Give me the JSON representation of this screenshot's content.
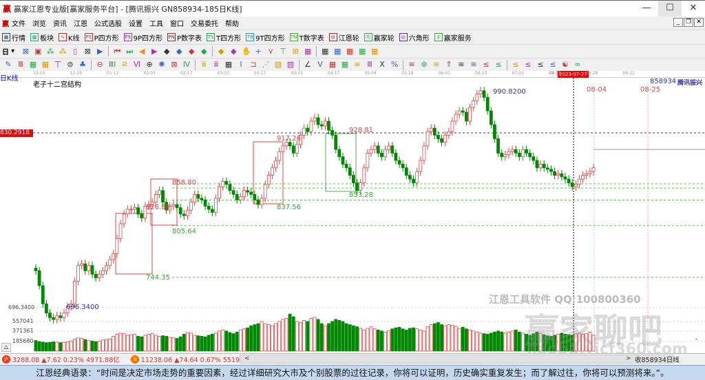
{
  "window": {
    "logo": "赢",
    "title": "赢家江恩专业版[赢家服务平台] - [腾讯振兴  GN858934-185日K线]",
    "minimize": "—",
    "maximize": "☐",
    "close": "✕"
  },
  "menu": {
    "logo": "赢",
    "items": [
      "文件",
      "浏览",
      "资讯",
      "江恩",
      "公式选股",
      "设置",
      "工具",
      "窗口",
      "交易委托",
      "帮助"
    ],
    "mdi": [
      "_",
      "❐",
      "✕"
    ]
  },
  "toolbar1": [
    {
      "icon": "▦",
      "label": "行情",
      "color": "#246"
    },
    {
      "icon": "▩",
      "label": "板块",
      "color": "#2a7"
    },
    {
      "icon": "∿",
      "label": "K线",
      "color": "#d22"
    },
    {
      "icon": "PS",
      "label": "P四方形",
      "color": "#c33"
    },
    {
      "icon": "P9",
      "label": "9P四方形",
      "color": "#a3a"
    },
    {
      "icon": "PN",
      "label": "P数字表",
      "color": "#933"
    },
    {
      "icon": "TS",
      "label": "T四方形",
      "color": "#2a4"
    },
    {
      "icon": "T9",
      "label": "9T四方形",
      "color": "#29a"
    },
    {
      "icon": "TN",
      "label": "T数字表",
      "color": "#4a2"
    },
    {
      "icon": "◎",
      "label": "江恩轮",
      "color": "#a22"
    },
    {
      "icon": "㊈",
      "label": "赢家轮",
      "color": "#3a5"
    },
    {
      "icon": "◎",
      "label": "六角形",
      "color": "#62a"
    },
    {
      "icon": "$",
      "label": "赢家服务",
      "color": "#3a3"
    }
  ],
  "toolbar2": {
    "period": "日",
    "icons": [
      "⊠",
      "▣",
      "⁂",
      "⁂",
      "▯",
      "⊠",
      "▶",
      "⏮",
      "⏭",
      "◀",
      "▶",
      "◆",
      "◆",
      "◆",
      "◆",
      "◆",
      "◆",
      "✋",
      "+",
      "⋎",
      "⊤",
      "⊞",
      "▦",
      "▦",
      "▦",
      "▦",
      "▦",
      "▦"
    ]
  },
  "toolbar3": {
    "icons": [
      "✎",
      "Ⅲ",
      "▦",
      "▦",
      "ㄒ",
      "⊜",
      "♣",
      "⊖",
      "ⅢⅠ",
      "ㄹ",
      "Ⅵ",
      "⊕",
      "✺",
      "⊠",
      "Ⅳ",
      "ⅲ",
      "ⅲ",
      "▦",
      "Ⅰ",
      "⊐",
      "⋰",
      "▧",
      "▧",
      "∠",
      "V",
      "▦",
      "▦",
      "≡",
      "Ⅲ",
      "Ⅹ",
      "%",
      "≡",
      "⊛",
      "≡",
      "⇑",
      "≡",
      "≡",
      "≤",
      "≤",
      "≤",
      "≤",
      "≤",
      "≤",
      "☯",
      "∞"
    ]
  },
  "date_axis": {
    "ticks": [
      "12-15",
      "12-29",
      "01-13",
      "02-03",
      "02-17",
      "03-03",
      "03-17",
      "03-31",
      "04-17",
      "05-04",
      "05-18",
      "06-01",
      "06-15",
      "07-03",
      "07-17",
      "08-14",
      "08-28",
      "09-11"
    ],
    "cursor_date": "2023-07-27"
  },
  "chart": {
    "period_label": "日K线",
    "indicator_title": "老子十二宫结构",
    "code": "858934",
    "name": "腾讯振兴",
    "cursor_price": "830.2918",
    "low_axis_label": "696.3400",
    "high_label": "990.8200",
    "low_label": "696.3400",
    "future_dates": [
      "08-04",
      "08-25"
    ],
    "levels": {
      "l858": "858.80",
      "l826": "826.88",
      "l805": "805.64",
      "l744": "744.35",
      "l917": "917.26",
      "l837": "837.56",
      "l928": "928.81",
      "l853": "853.28"
    },
    "watermark1": "江恩工具软件  QQ:100800360",
    "watermark2": "赢家聊吧",
    "watermark3": "liaoba.yjcf360.com",
    "volume_ticks": [
      "557041",
      "371361",
      "185680"
    ],
    "collapse": "△",
    "minus": "-"
  },
  "chart_data": {
    "type": "candlestick",
    "ylim": [
      690,
      1000
    ],
    "closes": [
      752,
      735,
      715,
      705,
      700,
      698,
      702,
      700,
      705,
      712,
      715,
      740,
      758,
      760,
      752,
      758,
      748,
      744,
      748,
      752,
      758,
      765,
      772,
      790,
      808,
      820,
      826,
      826,
      828,
      820,
      815,
      830,
      832,
      835,
      845,
      850,
      835,
      825,
      830,
      832,
      828,
      820,
      818,
      825,
      835,
      845,
      840,
      838,
      830,
      826,
      822,
      840,
      855,
      862,
      858,
      850,
      845,
      838,
      842,
      850,
      848,
      845,
      838,
      832,
      840,
      858,
      870,
      880,
      890,
      902,
      910,
      915,
      910,
      900,
      912,
      925,
      935,
      930,
      945,
      950,
      940,
      938,
      945,
      932,
      925,
      905,
      895,
      885,
      880,
      870,
      860,
      850,
      860,
      880,
      900,
      905,
      910,
      900,
      895,
      905,
      910,
      900,
      890,
      885,
      880,
      870,
      865,
      860,
      875,
      890,
      910,
      930,
      935,
      925,
      920,
      915,
      925,
      930,
      945,
      955,
      960,
      958,
      945,
      965,
      975,
      985,
      990,
      980,
      960,
      940,
      920,
      900,
      895,
      898,
      902,
      905,
      900,
      895,
      905,
      900,
      895,
      890,
      880,
      885,
      880,
      878,
      875,
      870,
      872,
      868,
      865,
      860,
      855,
      858,
      865,
      870,
      872,
      875,
      880
    ],
    "volumes": [
      200,
      180,
      170,
      160,
      165,
      175,
      170,
      160,
      165,
      175,
      190,
      230,
      250,
      240,
      220,
      200,
      190,
      180,
      190,
      210,
      220,
      230,
      280,
      320,
      340,
      330,
      300,
      310,
      320,
      280,
      270,
      300,
      320,
      330,
      300,
      280,
      290,
      280,
      260,
      250,
      240,
      270,
      320,
      350,
      340,
      300,
      290,
      280,
      270,
      300,
      320,
      340,
      380,
      400,
      380,
      350,
      330,
      360,
      400,
      420,
      440,
      480,
      500,
      520,
      560,
      520,
      500,
      480,
      520,
      560,
      600,
      620,
      700,
      650,
      560,
      540,
      580,
      560,
      620,
      640,
      600,
      520,
      480,
      520,
      560,
      600,
      580,
      560,
      520,
      500,
      480,
      460,
      430,
      400,
      430,
      460,
      420,
      400,
      380,
      360,
      390,
      420,
      440,
      450,
      420,
      400,
      430,
      440,
      420,
      400,
      380,
      460,
      500,
      520,
      540,
      500,
      480,
      500,
      490,
      470,
      430,
      450,
      420,
      400,
      380,
      360,
      340,
      330,
      320,
      340,
      360,
      380,
      360,
      340,
      360,
      380,
      400,
      360,
      340,
      320,
      300,
      330,
      360,
      340,
      310,
      290,
      280,
      300,
      320,
      340,
      320,
      310,
      300,
      330,
      340,
      320,
      330,
      360,
      300,
      290,
      310,
      300,
      280,
      300,
      350
    ],
    "title": "腾讯振兴 GN858934 日K线"
  },
  "status": {
    "sh": "3288.08 ▲7.62 0.23% 4971.88亿",
    "sz": "11238.06 ▲74.64 0.67% 5519.72亿",
    "sh_icon": "沪",
    "sz_icon": "深",
    "left": "<",
    "right": ">",
    "close_label": "收858934日线"
  },
  "quote": "江恩经典语录：“时间是决定市场走势的重要因素，经过详细研究大市及个别股票的过往记录，你将可以证明，历史确实重复发生；而了解过往，你将可以预测将来。”。"
}
